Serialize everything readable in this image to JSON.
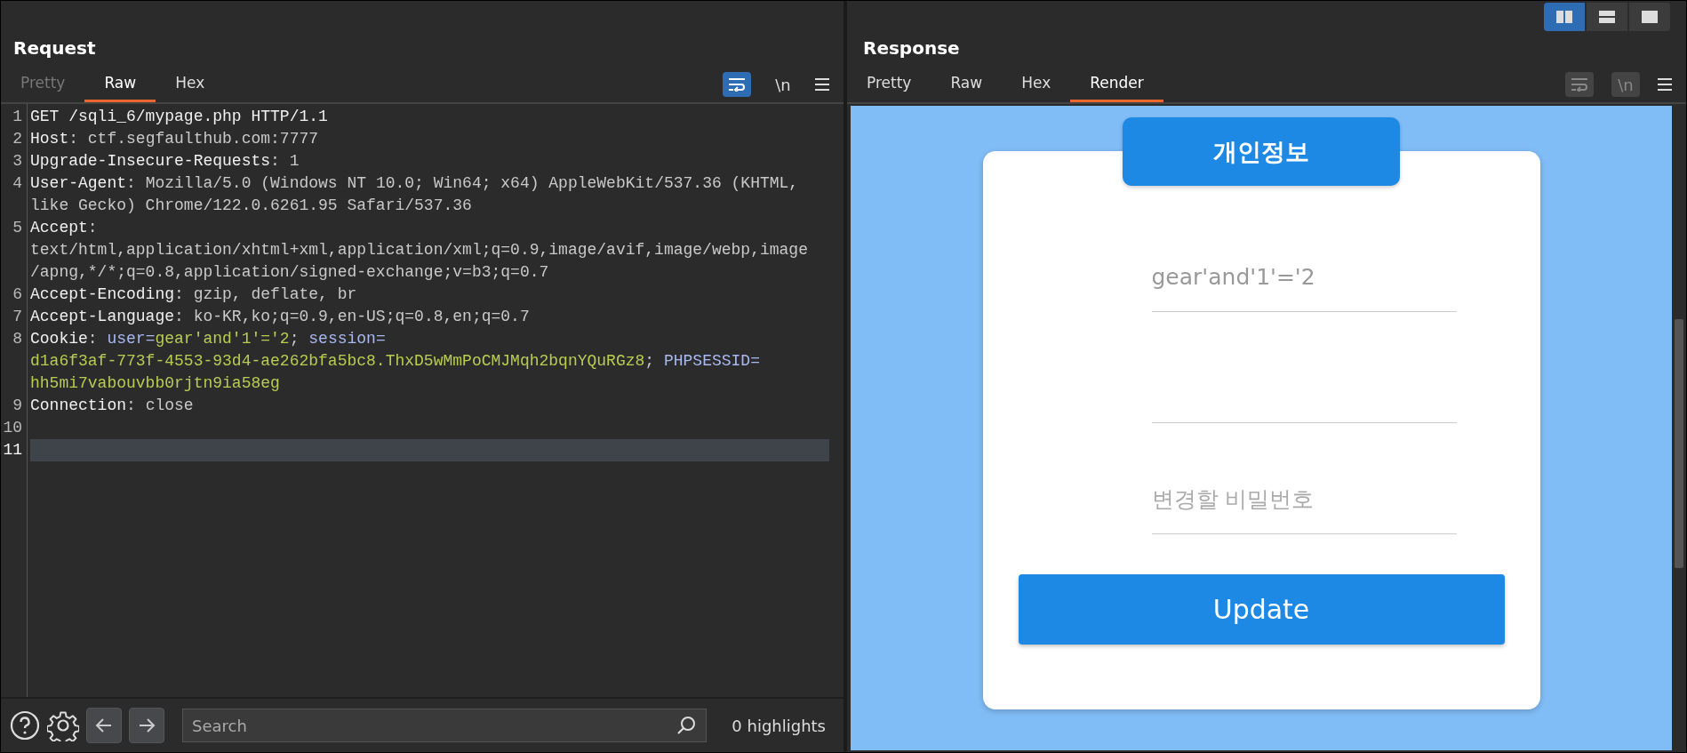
{
  "layout_switch": [
    {
      "kind": "side",
      "selected": true
    },
    {
      "kind": "stacked",
      "selected": false
    },
    {
      "kind": "single",
      "selected": false
    }
  ],
  "request": {
    "title": "Request",
    "tabs": [
      {
        "label": "Pretty",
        "selected": false,
        "disabled": true
      },
      {
        "label": "Raw",
        "selected": true,
        "disabled": false
      },
      {
        "label": "Hex",
        "selected": false,
        "disabled": false
      }
    ],
    "toggles": [
      {
        "kind": "wrap",
        "on": true,
        "disabled": false
      },
      {
        "kind": "newline",
        "label": "\\n",
        "on": false,
        "disabled": false
      }
    ],
    "lines": [
      {
        "number": "1",
        "current": false,
        "rows": [
          {
            "segments": [
              {
                "kind": "name",
                "text": "GET /sqli_6/mypage.php HTTP/1.1"
              }
            ]
          }
        ]
      },
      {
        "number": "2",
        "current": false,
        "rows": [
          {
            "segments": [
              {
                "kind": "name",
                "text": "Host"
              },
              {
                "kind": "text",
                "text": ": ctf.segfaulthub.com:7777"
              }
            ]
          }
        ]
      },
      {
        "number": "3",
        "current": false,
        "rows": [
          {
            "segments": [
              {
                "kind": "name",
                "text": "Upgrade-Insecure-Requests"
              },
              {
                "kind": "text",
                "text": ": 1"
              }
            ]
          }
        ]
      },
      {
        "number": "4",
        "current": false,
        "rows": [
          {
            "segments": [
              {
                "kind": "name",
                "text": "User-Agent"
              },
              {
                "kind": "text",
                "text": ": Mozilla/5.0 (Windows NT 10.0; Win64; x64) AppleWebKit/537.36 (KHTML,"
              }
            ]
          },
          {
            "segments": [
              {
                "kind": "text",
                "text": "like Gecko) Chrome/122.0.6261.95 Safari/537.36"
              }
            ]
          }
        ]
      },
      {
        "number": "5",
        "current": false,
        "rows": [
          {
            "segments": [
              {
                "kind": "name",
                "text": "Accept"
              },
              {
                "kind": "text",
                "text": ":"
              }
            ]
          },
          {
            "segments": [
              {
                "kind": "text",
                "text": "text/html,application/xhtml+xml,application/xml;q=0.9,image/avif,image/webp,image"
              }
            ]
          },
          {
            "segments": [
              {
                "kind": "text",
                "text": "/apng,*/*;q=0.8,application/signed-exchange;v=b3;q=0.7"
              }
            ]
          }
        ]
      },
      {
        "number": "6",
        "current": false,
        "rows": [
          {
            "segments": [
              {
                "kind": "name",
                "text": "Accept-Encoding"
              },
              {
                "kind": "text",
                "text": ": gzip, deflate, br"
              }
            ]
          }
        ]
      },
      {
        "number": "7",
        "current": false,
        "rows": [
          {
            "segments": [
              {
                "kind": "name",
                "text": "Accept-Language"
              },
              {
                "kind": "text",
                "text": ": ko-KR,ko;q=0.9,en-US;q=0.8,en;q=0.7"
              }
            ]
          }
        ]
      },
      {
        "number": "8",
        "current": false,
        "rows": [
          {
            "segments": [
              {
                "kind": "name",
                "text": "Cookie"
              },
              {
                "kind": "text",
                "text": ": "
              },
              {
                "kind": "cookie_name",
                "text": "user="
              },
              {
                "kind": "cookie_value",
                "text": "gear'and'1'='2"
              },
              {
                "kind": "text",
                "text": "; "
              },
              {
                "kind": "cookie_name",
                "text": "session="
              }
            ]
          },
          {
            "segments": [
              {
                "kind": "cookie_value",
                "text": "d1a6f3af-773f-4553-93d4-ae262bfa5bc8.ThxD5wMmPoCMJMqh2bqnYQuRGz8"
              },
              {
                "kind": "text",
                "text": "; "
              },
              {
                "kind": "cookie_name",
                "text": "PHPSESSID="
              }
            ]
          },
          {
            "segments": [
              {
                "kind": "cookie_value",
                "text": "hh5mi7vabouvbb0rjtn9ia58eg"
              }
            ]
          }
        ]
      },
      {
        "number": "9",
        "current": false,
        "rows": [
          {
            "segments": [
              {
                "kind": "name",
                "text": "Connection"
              },
              {
                "kind": "text",
                "text": ": close"
              }
            ]
          }
        ]
      },
      {
        "number": "10",
        "current": false
      },
      {
        "number": "11",
        "current": true
      }
    ],
    "footer": {
      "search": {
        "placeholder": "Search"
      },
      "highlights": "0 highlights"
    }
  },
  "response": {
    "title": "Response",
    "tabs": [
      {
        "label": "Pretty",
        "selected": false,
        "disabled": false
      },
      {
        "label": "Raw",
        "selected": false,
        "disabled": false
      },
      {
        "label": "Hex",
        "selected": false,
        "disabled": false
      },
      {
        "label": "Render",
        "selected": true,
        "disabled": false
      }
    ],
    "toggles": [
      {
        "kind": "wrap",
        "disabled": true
      },
      {
        "kind": "newline",
        "label": "\\n",
        "disabled": true
      }
    ],
    "render": {
      "heading": "개인정보",
      "fields": [
        {
          "kind": "text",
          "value": "gear'and'1'='2"
        },
        {
          "kind": "blank"
        },
        {
          "kind": "password",
          "placeholder": "변경할 비밀번호"
        }
      ],
      "button": "Update"
    }
  }
}
